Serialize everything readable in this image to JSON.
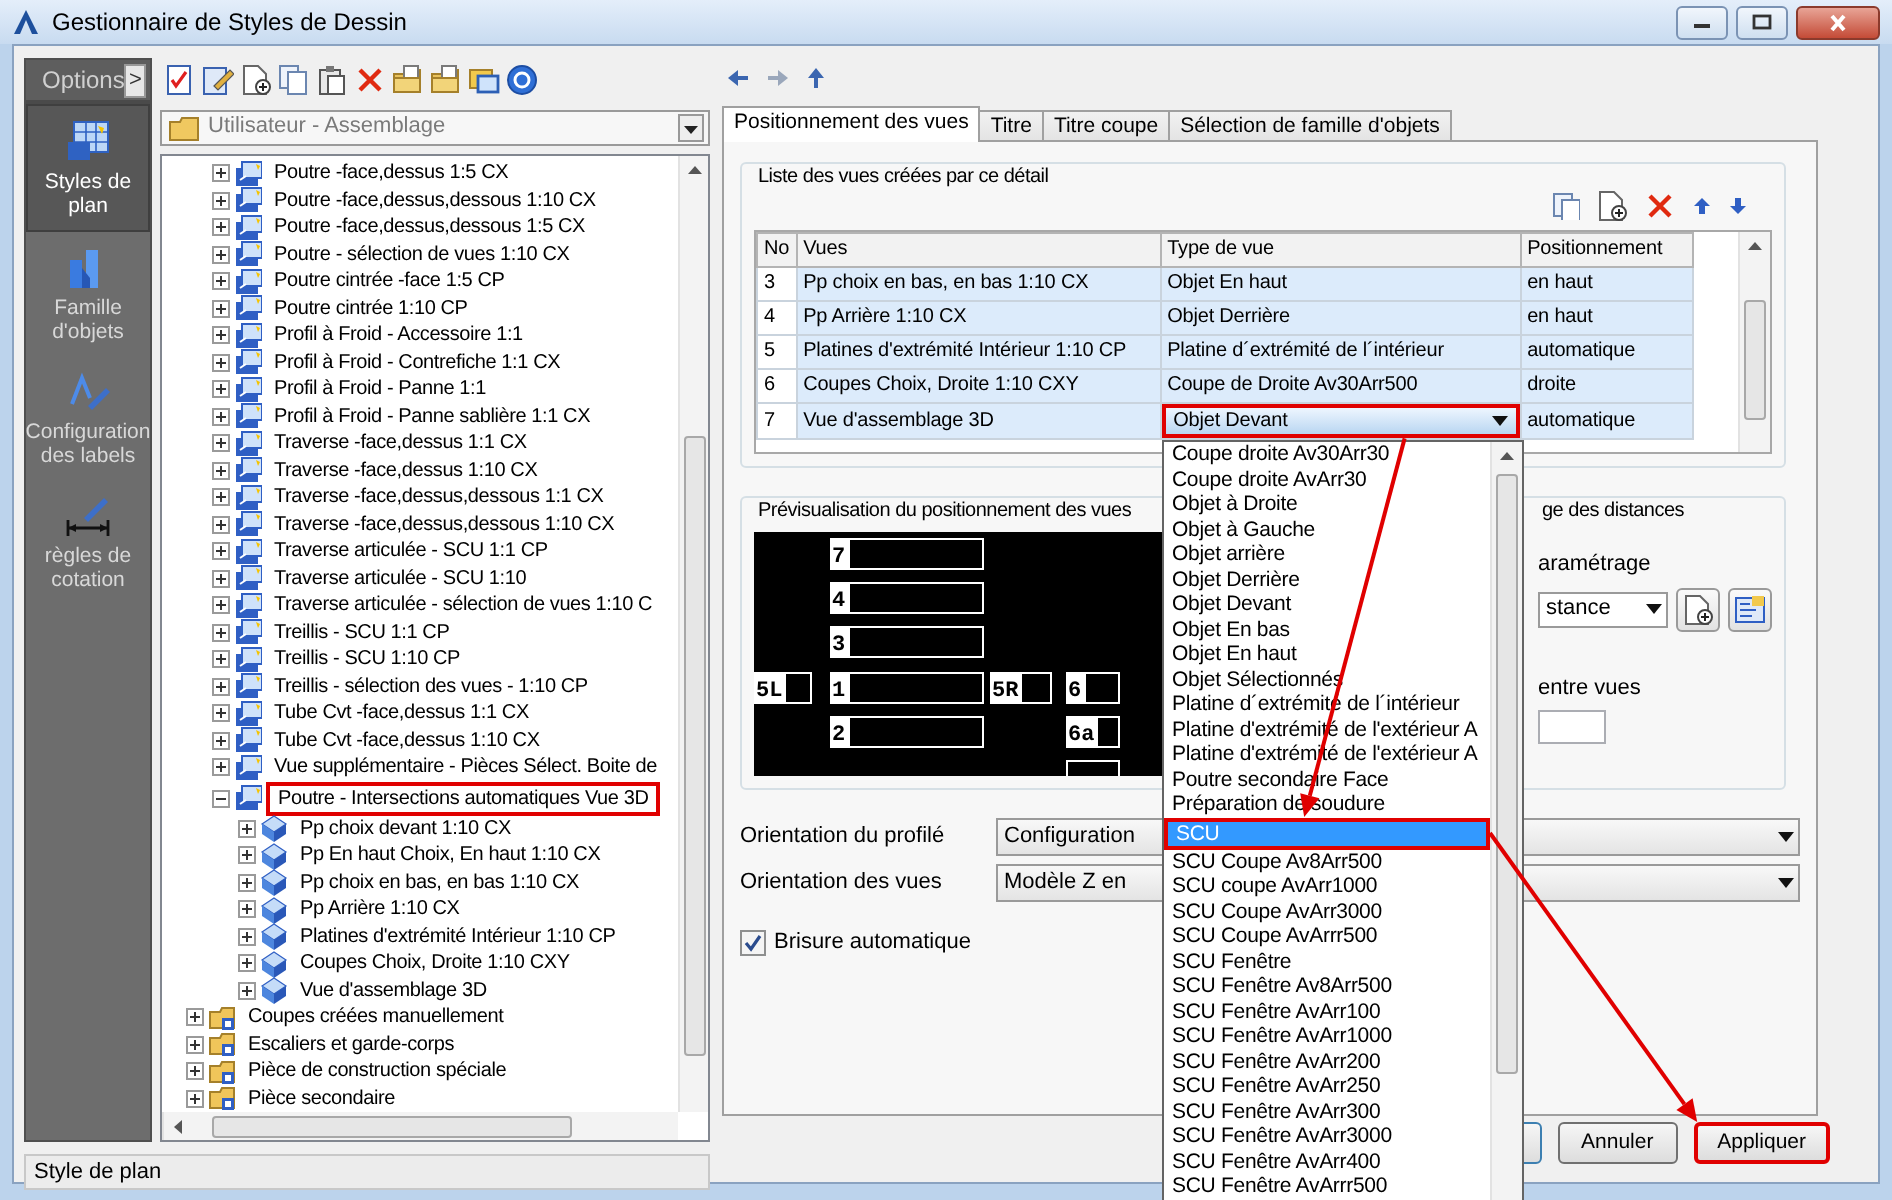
{
  "window": {
    "title": "Gestionnaire de Styles de Dessin"
  },
  "sidebar": {
    "header": "Options",
    "toggle": ">",
    "items": [
      {
        "label": "Styles de plan",
        "kind": "plan",
        "selected": true
      },
      {
        "label": "Famille d'objets",
        "kind": "family",
        "selected": false
      },
      {
        "label": "Configuration des labels",
        "kind": "labels",
        "selected": false
      },
      {
        "label": "règles de cotation",
        "kind": "dimension",
        "selected": false
      }
    ]
  },
  "style_selector": {
    "value": "Utilisateur - Assemblage"
  },
  "tree": {
    "items": [
      {
        "children": [
          {
            "label": "Poutre -face,dessus 1:5 CX",
            "kind": "style",
            "expanded": false,
            "highlighted": false
          },
          {
            "label": "Poutre -face,dessus,dessous 1:10 CX",
            "kind": "style",
            "expanded": false,
            "highlighted": false
          },
          {
            "label": "Poutre -face,dessus,dessous 1:5 CX",
            "kind": "style",
            "expanded": false,
            "highlighted": false
          },
          {
            "label": "Poutre - sélection de vues 1:10 CX",
            "kind": "style",
            "expanded": false,
            "highlighted": false
          },
          {
            "label": "Poutre cintrée -face 1:5 CP",
            "kind": "style",
            "expanded": false,
            "highlighted": false
          },
          {
            "label": "Poutre cintrée 1:10 CP",
            "kind": "style",
            "expanded": false,
            "highlighted": false
          },
          {
            "label": "Profil à Froid - Accessoire 1:1",
            "kind": "style",
            "expanded": false,
            "highlighted": false
          },
          {
            "label": "Profil à Froid - Contrefiche 1:1 CX",
            "kind": "style",
            "expanded": false,
            "highlighted": false
          },
          {
            "label": "Profil à Froid - Panne 1:1",
            "kind": "style",
            "expanded": false,
            "highlighted": false
          },
          {
            "label": "Profil à Froid - Panne sablière 1:1 CX",
            "kind": "style",
            "expanded": false,
            "highlighted": false
          },
          {
            "label": "Traverse -face,dessus 1:1 CX",
            "kind": "style",
            "expanded": false,
            "highlighted": false
          },
          {
            "label": "Traverse -face,dessus 1:10 CX",
            "kind": "style",
            "expanded": false,
            "highlighted": false
          },
          {
            "label": "Traverse -face,dessus,dessous 1:1 CX",
            "kind": "style",
            "expanded": false,
            "highlighted": false
          },
          {
            "label": "Traverse -face,dessus,dessous 1:10 CX",
            "kind": "style",
            "expanded": false,
            "highlighted": false
          },
          {
            "label": "Traverse articulée - SCU 1:1 CP",
            "kind": "style",
            "expanded": false,
            "highlighted": false
          },
          {
            "label": "Traverse articulée - SCU 1:10",
            "kind": "style",
            "expanded": false,
            "highlighted": false
          },
          {
            "label": "Traverse articulée - sélection de vues 1:10 C",
            "kind": "style",
            "expanded": false,
            "highlighted": false
          },
          {
            "label": "Treillis - SCU 1:1 CP",
            "kind": "style",
            "expanded": false,
            "highlighted": false
          },
          {
            "label": "Treillis - SCU 1:10 CP",
            "kind": "style",
            "expanded": false,
            "highlighted": false
          },
          {
            "label": "Treillis - sélection des vues - 1:10 CP",
            "kind": "style",
            "expanded": false,
            "highlighted": false
          },
          {
            "label": "Tube Cvt -face,dessus 1:1 CX",
            "kind": "style",
            "expanded": false,
            "highlighted": false
          },
          {
            "label": "Tube Cvt -face,dessus 1:10 CX",
            "kind": "style",
            "expanded": false,
            "highlighted": false
          },
          {
            "label": "Vue supplémentaire - Pièces Sélect. Boite de",
            "kind": "style",
            "expanded": false,
            "highlighted": false
          },
          {
            "label": "Poutre - Intersections automatiques Vue 3D",
            "kind": "style",
            "expanded": true,
            "highlighted": true,
            "children": [
              {
                "label": "Pp choix devant 1:10 CX",
                "kind": "view",
                "expanded": false,
                "highlighted": false
              },
              {
                "label": "Pp En haut Choix, En haut 1:10 CX",
                "kind": "view",
                "expanded": false,
                "highlighted": false
              },
              {
                "label": "Pp choix en bas, en bas 1:10 CX",
                "kind": "view",
                "expanded": false,
                "highlighted": false
              },
              {
                "label": "Pp Arrière 1:10 CX",
                "kind": "view",
                "expanded": false,
                "highlighted": false
              },
              {
                "label": "Platines d'extrémité Intérieur 1:10 CP",
                "kind": "view",
                "expanded": false,
                "highlighted": false
              },
              {
                "label": "Coupes Choix, Droite 1:10 CXY",
                "kind": "view",
                "expanded": false,
                "highlighted": false
              },
              {
                "label": "Vue d'assemblage 3D",
                "kind": "view",
                "expanded": false,
                "highlighted": false
              }
            ]
          }
        ]
      },
      {
        "label": "Coupes créées manuellement",
        "kind": "folder",
        "expanded": false,
        "highlighted": false
      },
      {
        "label": "Escaliers et garde-corps",
        "kind": "folder",
        "expanded": false,
        "highlighted": false
      },
      {
        "label": "Pièce de construction spéciale",
        "kind": "folder",
        "expanded": false,
        "highlighted": false
      },
      {
        "label": "Pièce secondaire",
        "kind": "folder",
        "expanded": false,
        "highlighted": false
      }
    ]
  },
  "status_bar": "Style de plan",
  "tabs": [
    {
      "label": "Positionnement des vues",
      "selected": true
    },
    {
      "label": "Titre",
      "selected": false
    },
    {
      "label": "Titre coupe",
      "selected": false
    },
    {
      "label": "Sélection de famille d'objets",
      "selected": false
    }
  ],
  "views_list": {
    "title": "Liste des vues créées par ce détail",
    "columns": [
      "No",
      "Vues",
      "Type de vue",
      "Positionnement"
    ],
    "rows": [
      {
        "no": "3",
        "view": "Pp choix en bas, en bas 1:10 CX",
        "type": "Objet En haut",
        "position": "en haut",
        "editing": false,
        "highlighted": false
      },
      {
        "no": "4",
        "view": "Pp Arrière 1:10 CX",
        "type": "Objet Derrière",
        "position": "en haut",
        "editing": false,
        "highlighted": false
      },
      {
        "no": "5",
        "view": "Platines d'extrémité Intérieur 1:10 CP",
        "type": "Platine d´extrémité de l´intérieur",
        "position": "automatique",
        "editing": false,
        "highlighted": false
      },
      {
        "no": "6",
        "view": "Coupes Choix, Droite 1:10 CXY",
        "type": "Coupe de Droite Av30Arr500",
        "position": "droite",
        "editing": false,
        "highlighted": false
      },
      {
        "no": "7",
        "view": "Vue d'assemblage 3D",
        "type": "Objet Devant",
        "position": "automatique",
        "editing": true,
        "highlighted": true
      }
    ]
  },
  "dropdown": {
    "items": [
      {
        "label": "Coupe droite Av30Arr30",
        "selected": false,
        "highlighted": false
      },
      {
        "label": "Coupe droite AvArr30",
        "selected": false,
        "highlighted": false
      },
      {
        "label": "Objet à Droite",
        "selected": false,
        "highlighted": false
      },
      {
        "label": "Objet à Gauche",
        "selected": false,
        "highlighted": false
      },
      {
        "label": "Objet arrière",
        "selected": false,
        "highlighted": false
      },
      {
        "label": "Objet Derrière",
        "selected": false,
        "highlighted": false
      },
      {
        "label": "Objet Devant",
        "selected": false,
        "highlighted": false
      },
      {
        "label": "Objet En bas",
        "selected": false,
        "highlighted": false
      },
      {
        "label": "Objet En haut",
        "selected": false,
        "highlighted": false
      },
      {
        "label": "Objet Sélectionnés",
        "selected": false,
        "highlighted": false
      },
      {
        "label": "Platine d´extrémité de l´intérieur",
        "selected": false,
        "highlighted": false
      },
      {
        "label": "Platine d'extrémité de l'extérieur A",
        "selected": false,
        "highlighted": false
      },
      {
        "label": "Platine d'extrémité de l'extérieur A",
        "selected": false,
        "highlighted": false
      },
      {
        "label": "Poutre secondaire Face",
        "selected": false,
        "highlighted": false
      },
      {
        "label": "Préparation de soudure",
        "selected": false,
        "highlighted": false
      },
      {
        "label": "SCU",
        "selected": true,
        "highlighted": true
      },
      {
        "label": "SCU Coupe Av8Arr500",
        "selected": false,
        "highlighted": false
      },
      {
        "label": "SCU coupe AvArr1000",
        "selected": false,
        "highlighted": false
      },
      {
        "label": "SCU Coupe AvArr3000",
        "selected": false,
        "highlighted": false
      },
      {
        "label": "SCU Coupe AvArrr500",
        "selected": false,
        "highlighted": false
      },
      {
        "label": "SCU Fenêtre",
        "selected": false,
        "highlighted": false
      },
      {
        "label": "SCU Fenêtre Av8Arr500",
        "selected": false,
        "highlighted": false
      },
      {
        "label": "SCU Fenêtre AvArr100",
        "selected": false,
        "highlighted": false
      },
      {
        "label": "SCU Fenêtre AvArr1000",
        "selected": false,
        "highlighted": false
      },
      {
        "label": "SCU Fenêtre AvArr200",
        "selected": false,
        "highlighted": false
      },
      {
        "label": "SCU Fenêtre AvArr250",
        "selected": false,
        "highlighted": false
      },
      {
        "label": "SCU Fenêtre AvArr300",
        "selected": false,
        "highlighted": false
      },
      {
        "label": "SCU Fenêtre AvArr3000",
        "selected": false,
        "highlighted": false
      },
      {
        "label": "SCU Fenêtre AvArr400",
        "selected": false,
        "highlighted": false
      },
      {
        "label": "SCU Fenêtre AvArrr500",
        "selected": false,
        "highlighted": false
      }
    ]
  },
  "preview": {
    "title": "Prévisualisation du positionnement des vues",
    "views": [
      {
        "label": "7"
      },
      {
        "label": "4"
      },
      {
        "label": "3"
      },
      {
        "label": "5L"
      },
      {
        "label": "1"
      },
      {
        "label": "5R"
      },
      {
        "label": "6"
      },
      {
        "label": "2"
      },
      {
        "label": "6a"
      }
    ]
  },
  "distances": {
    "title": "ge des distances",
    "setting_label": "aramétrage",
    "setting_value": "stance",
    "gap_label": "entre vues"
  },
  "orientation": [
    {
      "label": "Orientation du profilé",
      "value": "Configuration"
    },
    {
      "label": "Orientation des vues",
      "value": "Modèle Z en"
    }
  ],
  "auto_break": {
    "label": "Brisure automatique",
    "checked": true
  },
  "buttons": [
    {
      "label": "Annuler",
      "highlighted": false
    },
    {
      "label": "Appliquer",
      "highlighted": true
    }
  ],
  "annotation_arrows": true
}
